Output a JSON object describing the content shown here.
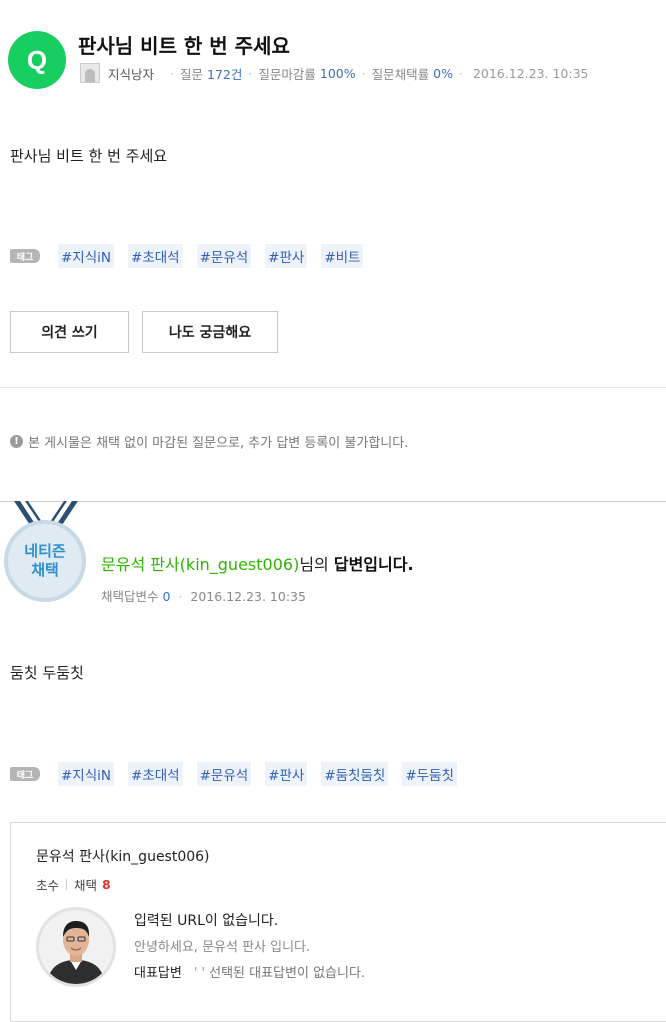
{
  "question": {
    "badge": "Q",
    "title": "판사님 비트 한 번 주세요",
    "author": "지식낭자",
    "meta": {
      "q_label": "질문",
      "q_count": "172건",
      "close_label": "질문마감률",
      "close_rate": "100%",
      "adopt_label": "질문채택률",
      "adopt_rate": "0%",
      "date": "2016.12.23. 10:35"
    },
    "body": "판사님 비트 한 번 주세요",
    "tag_label": "태그",
    "tags": [
      "#지식iN",
      "#초대석",
      "#문유석",
      "#판사",
      "#비트"
    ],
    "buttons": {
      "opinion": "의견 쓰기",
      "curious": "나도 궁금해요"
    }
  },
  "notice": "본 게시물은 채택 없이 마감된 질문으로, 추가 답변 등록이 불가합니다.",
  "answer": {
    "medal_line1": "네티즌",
    "medal_line2": "채택",
    "author_link": "문유석 판사(kin_guest006)",
    "title_suffix_1": "님의 ",
    "title_suffix_2": "답변입니다.",
    "meta_label": "채택답변수",
    "meta_count": "0",
    "meta_date": "2016.12.23. 10:35",
    "body": "둠칫 두둠칫",
    "tag_label": "태그",
    "tags": [
      "#지식iN",
      "#초대석",
      "#문유석",
      "#판사",
      "#둠칫둠칫",
      "#두둠칫"
    ]
  },
  "profile": {
    "name": "문유석 판사(kin_guest006)",
    "level": "초수",
    "adopt_label": "채택",
    "adopt_count": "8",
    "line1": "입력된 URL이 없습니다.",
    "line2": "안녕하세요, 문유석 판사 입니다.",
    "rep_label": "대표답변",
    "rep_value": "선택된 대표답변이 없습니다."
  },
  "colors": {
    "q_green": "#19ce60",
    "link_green": "#2db400",
    "link_blue": "#3b6ec4",
    "tag_bg": "#eef3fb",
    "adopt_red": "#e0322c",
    "medal_blue": "#2e8fcf"
  }
}
